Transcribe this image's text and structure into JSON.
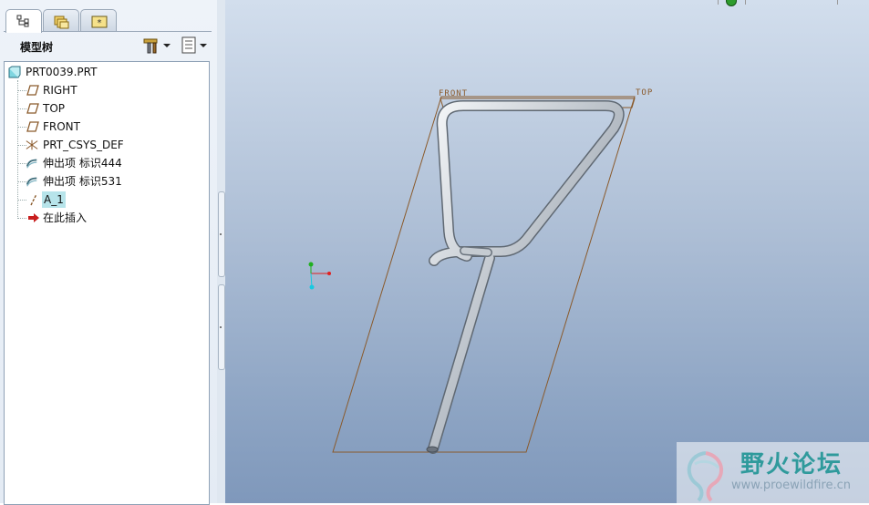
{
  "panel": {
    "title": "模型树"
  },
  "tree": {
    "items": [
      {
        "label": "PRT0039.PRT",
        "icon": "part-icon"
      },
      {
        "label": "RIGHT",
        "icon": "datum-plane-icon"
      },
      {
        "label": "TOP",
        "icon": "datum-plane-icon"
      },
      {
        "label": "FRONT",
        "icon": "datum-plane-icon"
      },
      {
        "label": "PRT_CSYS_DEF",
        "icon": "csys-icon"
      },
      {
        "label": "伸出项 标识444",
        "icon": "sweep-feature-icon"
      },
      {
        "label": "伸出项 标识531",
        "icon": "sweep-feature-icon"
      },
      {
        "label": "A_1",
        "icon": "datum-axis-icon"
      },
      {
        "label": "在此插入",
        "icon": "insert-here-arrow-icon"
      }
    ]
  },
  "viewport": {
    "plane_label_front": "FRONT",
    "plane_label_top": "TOP"
  },
  "watermark": {
    "title": "野火论坛",
    "url": "www.proewildfire.cn"
  },
  "colors": {
    "datum": "#8a5a2b",
    "selection": "#b7e4ea",
    "insert_arrow": "#c81e1e"
  }
}
